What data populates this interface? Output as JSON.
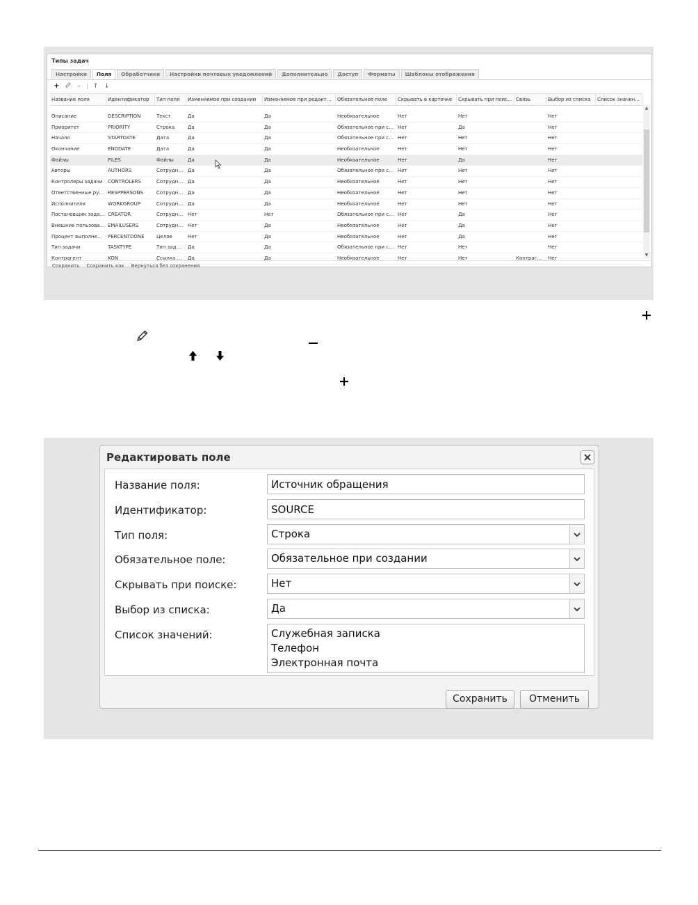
{
  "screen1": {
    "window_title": "Типы задач",
    "tabs": [
      {
        "label": "Настройки"
      },
      {
        "label": "Поля"
      },
      {
        "label": "Обработчики"
      },
      {
        "label": "Настройки почтовых уведомлений"
      },
      {
        "label": "Дополнительно"
      },
      {
        "label": "Доступ"
      },
      {
        "label": "Форматы"
      },
      {
        "label": "Шаблоны отображения"
      }
    ],
    "active_tab": "Поля",
    "toolbar_icons": [
      "plus-icon",
      "pencil-icon",
      "minus-icon",
      "arrow-up-icon",
      "arrow-down-icon"
    ],
    "columns": [
      "Название поля",
      "Идентификатор",
      "Тип поля",
      "Изменяемое при создании",
      "Изменяемое при редакт…",
      "Обязательное поле",
      "Скрывать в карточке",
      "Скрывать при поис…",
      "Связь",
      "Выбор из списка",
      "Список значен…"
    ],
    "rows": [
      [
        "Описание",
        "DESCRIPTION",
        "Текст",
        "Да",
        "Да",
        "Необязательное",
        "Нет",
        "Нет",
        "",
        "Нет",
        ""
      ],
      [
        "Приоритет",
        "PRIORITY",
        "Строка",
        "Да",
        "Да",
        "Обязательное при с…",
        "Нет",
        "Да",
        "",
        "Нет",
        ""
      ],
      [
        "Начало",
        "STARTDATE",
        "Дата",
        "Да",
        "Да",
        "Обязательное при с…",
        "Нет",
        "Нет",
        "",
        "Нет",
        ""
      ],
      [
        "Окончание",
        "ENDDATE",
        "Дата",
        "Да",
        "Да",
        "Необязательное",
        "Нет",
        "Нет",
        "",
        "Нет",
        ""
      ],
      [
        "Файлы",
        "FILES",
        "Файлы",
        "Да",
        "Да",
        "Необязательное",
        "Нет",
        "Да",
        "",
        "Нет",
        ""
      ],
      [
        "Авторы",
        "AUTHORS",
        "Сотрудн…",
        "Да",
        "Да",
        "Обязательное при с…",
        "Нет",
        "Нет",
        "",
        "Нет",
        ""
      ],
      [
        "Контролеры задачи",
        "CONTROLERS",
        "Сотрудн…",
        "Да",
        "Да",
        "Необязательное",
        "Нет",
        "Нет",
        "",
        "Нет",
        ""
      ],
      [
        "Ответственные ру…",
        "RESPPERSONS",
        "Сотрудн…",
        "Да",
        "Да",
        "Необязательное",
        "Нет",
        "Нет",
        "",
        "Нет",
        ""
      ],
      [
        "Исполнители",
        "WORKGROUP",
        "Сотрудн…",
        "Да",
        "Да",
        "Необязательное",
        "Нет",
        "Нет",
        "",
        "Нет",
        ""
      ],
      [
        "Постановщик зада…",
        "CREATOR",
        "Сотрудн…",
        "Нет",
        "Нет",
        "Обязательное при с…",
        "Нет",
        "Да",
        "",
        "Нет",
        ""
      ],
      [
        "Внешние пользова…",
        "EMAILUSERS",
        "Сотрудн…",
        "Нет",
        "Да",
        "Необязательное",
        "Нет",
        "Да",
        "",
        "Нет",
        ""
      ],
      [
        "Процент выполне…",
        "PERCENTDONE",
        "Целое",
        "Нет",
        "Да",
        "Необязательное",
        "Нет",
        "Да",
        "",
        "Нет",
        ""
      ],
      [
        "Тип задачи",
        "TASKTYPE",
        "Тип зад…",
        "Да",
        "Да",
        "Обязательное при с…",
        "Нет",
        "Нет",
        "",
        "Нет",
        ""
      ],
      [
        "Контрагент",
        "KON",
        "Ссылка …",
        "Да",
        "Да",
        "Необязательное",
        "Нет",
        "Нет",
        "Контраг…",
        "Нет",
        ""
      ]
    ],
    "footer_links": [
      "Сохранить",
      "Сохранить как",
      "Вернуться без сохранения"
    ]
  },
  "middle_icons": [
    "plus-icon",
    "pencil-icon",
    "minus-icon",
    "arrow-up-icon",
    "arrow-down-icon",
    "plus-icon"
  ],
  "dialog": {
    "title": "Редактировать поле",
    "fields": {
      "name_label": "Название поля:",
      "name_value": "Источник обращения",
      "id_label": "Идентификатор:",
      "id_value": "SOURCE",
      "type_label": "Тип поля:",
      "type_value": "Строка",
      "required_label": "Обязательное поле:",
      "required_value": "Обязательное при создании",
      "hide_search_label": "Скрывать при поиске:",
      "hide_search_value": "Нет",
      "list_choice_label": "Выбор из списка:",
      "list_choice_value": "Да",
      "values_label": "Список значений:",
      "values": [
        "Служебная записка",
        "Телефон",
        "Электронная почта"
      ]
    },
    "save_label": "Сохранить",
    "cancel_label": "Отменить"
  }
}
